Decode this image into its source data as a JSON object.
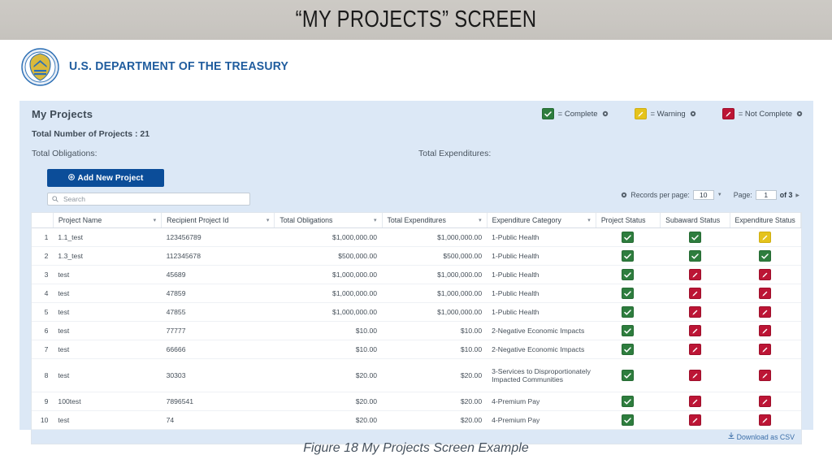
{
  "slide": {
    "title": "“MY PROJECTS” SCREEN",
    "caption": "Figure 18 My Projects Screen Example"
  },
  "header": {
    "agency_name": "U.S. DEPARTMENT OF THE TREASURY",
    "seal_icon": "treasury-seal-icon",
    "brand_color": "#1f5c9e"
  },
  "panel": {
    "title": "My Projects",
    "total_projects_label": "Total Number of Projects : 21",
    "total_obligations_label": "Total Obligations:",
    "total_expenditures_label": "Total Expenditures:"
  },
  "legend": {
    "items": [
      {
        "icon": "check-icon",
        "color": "#2e7d3e",
        "label": "= Complete",
        "info_icon": "gear-icon"
      },
      {
        "icon": "pencil-icon",
        "color": "#e5c31c",
        "label": "= Warning",
        "info_icon": "gear-icon"
      },
      {
        "icon": "pencil-icon",
        "color": "#bc1535",
        "label": "= Not Complete",
        "info_icon": "gear-icon"
      }
    ]
  },
  "toolbar": {
    "add_project_label": "Add New Project",
    "add_project_icon": "plus-circle-icon",
    "search_placeholder": "Search",
    "search_value": "",
    "search_icon": "search-icon"
  },
  "pagination": {
    "gear_icon": "gear-icon",
    "records_label": "Records per page:",
    "records_value": "10",
    "page_label": "Page:",
    "page_value": "1",
    "of_label": "of 3",
    "next_icon": "next-page-icon"
  },
  "table": {
    "columns": [
      {
        "key": "idx",
        "label": "",
        "sortable": false
      },
      {
        "key": "project_name",
        "label": "Project Name",
        "sortable": true
      },
      {
        "key": "recipient_project_id",
        "label": "Recipient Project Id",
        "sortable": true
      },
      {
        "key": "total_obligations",
        "label": "Total Obligations",
        "sortable": true
      },
      {
        "key": "total_expenditures",
        "label": "Total Expenditures",
        "sortable": true
      },
      {
        "key": "expenditure_category",
        "label": "Expenditure Category",
        "sortable": true
      },
      {
        "key": "project_status",
        "label": "Project Status",
        "sortable": false
      },
      {
        "key": "subaward_status",
        "label": "Subaward Status",
        "sortable": false
      },
      {
        "key": "expenditure_status",
        "label": "Expenditure Status",
        "sortable": false
      }
    ],
    "rows": [
      {
        "idx": "1",
        "project_name": "1.1_test",
        "recipient_project_id": "123456789",
        "total_obligations": "$1,000,000.00",
        "total_expenditures": "$1,000,000.00",
        "expenditure_category": "1-Public Health",
        "project_status": "complete",
        "subaward_status": "complete",
        "expenditure_status": "warning",
        "tall": false
      },
      {
        "idx": "2",
        "project_name": "1.3_test",
        "recipient_project_id": "112345678",
        "total_obligations": "$500,000.00",
        "total_expenditures": "$500,000.00",
        "expenditure_category": "1-Public Health",
        "project_status": "complete",
        "subaward_status": "complete",
        "expenditure_status": "complete",
        "tall": false
      },
      {
        "idx": "3",
        "project_name": "test",
        "recipient_project_id": "45689",
        "total_obligations": "$1,000,000.00",
        "total_expenditures": "$1,000,000.00",
        "expenditure_category": "1-Public Health",
        "project_status": "complete",
        "subaward_status": "not-complete",
        "expenditure_status": "not-complete",
        "tall": false
      },
      {
        "idx": "4",
        "project_name": "test",
        "recipient_project_id": "47859",
        "total_obligations": "$1,000,000.00",
        "total_expenditures": "$1,000,000.00",
        "expenditure_category": "1-Public Health",
        "project_status": "complete",
        "subaward_status": "not-complete",
        "expenditure_status": "not-complete",
        "tall": false
      },
      {
        "idx": "5",
        "project_name": "test",
        "recipient_project_id": "47855",
        "total_obligations": "$1,000,000.00",
        "total_expenditures": "$1,000,000.00",
        "expenditure_category": "1-Public Health",
        "project_status": "complete",
        "subaward_status": "not-complete",
        "expenditure_status": "not-complete",
        "tall": false
      },
      {
        "idx": "6",
        "project_name": "test",
        "recipient_project_id": "77777",
        "total_obligations": "$10.00",
        "total_expenditures": "$10.00",
        "expenditure_category": "2-Negative Economic Impacts",
        "project_status": "complete",
        "subaward_status": "not-complete",
        "expenditure_status": "not-complete",
        "tall": false
      },
      {
        "idx": "7",
        "project_name": "test",
        "recipient_project_id": "66666",
        "total_obligations": "$10.00",
        "total_expenditures": "$10.00",
        "expenditure_category": "2-Negative Economic Impacts",
        "project_status": "complete",
        "subaward_status": "not-complete",
        "expenditure_status": "not-complete",
        "tall": false
      },
      {
        "idx": "8",
        "project_name": "test",
        "recipient_project_id": "30303",
        "total_obligations": "$20.00",
        "total_expenditures": "$20.00",
        "expenditure_category": "3-Services to Disproportionately Impacted Communities",
        "project_status": "complete",
        "subaward_status": "not-complete",
        "expenditure_status": "not-complete",
        "tall": true
      },
      {
        "idx": "9",
        "project_name": "100test",
        "recipient_project_id": "7896541",
        "total_obligations": "$20.00",
        "total_expenditures": "$20.00",
        "expenditure_category": "4-Premium Pay",
        "project_status": "complete",
        "subaward_status": "not-complete",
        "expenditure_status": "not-complete",
        "tall": false
      },
      {
        "idx": "10",
        "project_name": "test",
        "recipient_project_id": "74",
        "total_obligations": "$20.00",
        "total_expenditures": "$20.00",
        "expenditure_category": "4-Premium Pay",
        "project_status": "complete",
        "subaward_status": "not-complete",
        "expenditure_status": "not-complete",
        "tall": false
      }
    ]
  },
  "footer": {
    "csv_label": "Download as CSV",
    "csv_icon": "download-icon"
  },
  "colors": {
    "panel_bg": "#dce8f6",
    "banner_bg": "#c9c6c1",
    "primary_button": "#0b4d99",
    "complete": "#2e7d3e",
    "warning": "#e5c31c",
    "not_complete": "#bc1535",
    "link": "#3b6ea8"
  }
}
